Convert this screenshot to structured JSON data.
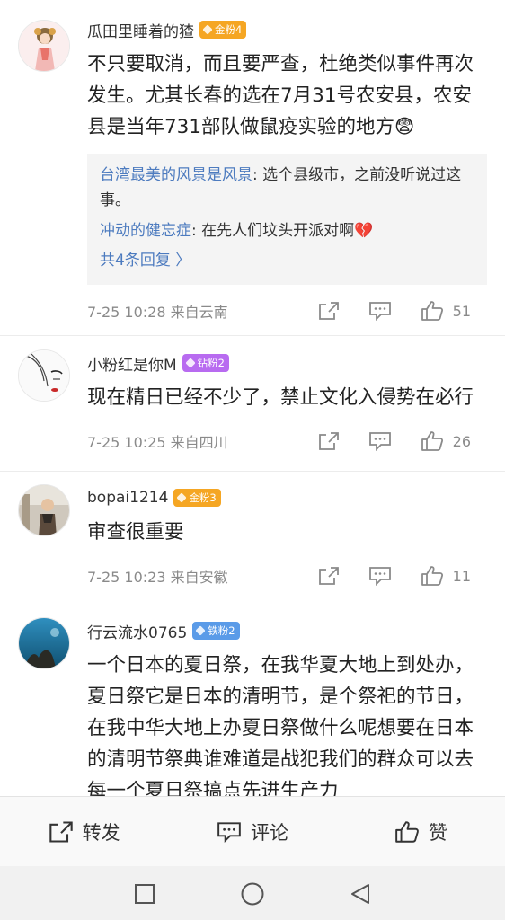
{
  "comments": [
    {
      "username": "瓜田里睡着的猹",
      "badge": "金粉4",
      "badge_color": "#f5a623",
      "text": "不只要取消，而且要严查，杜绝类似事件再次发生。尤其长春的选在7月31号农安县，农安县是当年731部队做鼠疫实验的地方😨",
      "replies": [
        {
          "name": "台湾最美的风景是风景",
          "text": ": 选个县级市，之前没听说过这事。"
        },
        {
          "name": "冲动的健忘症",
          "text": ": 在先人们坟头开派对啊💔"
        }
      ],
      "more_replies": "共4条回复 〉",
      "meta": "7-25 10:28  来自云南",
      "likes": "51"
    },
    {
      "username": "小粉红是你M",
      "badge": "钻粉2",
      "badge_color": "#b86bf0",
      "text": "现在精日已经不少了，禁止文化入侵势在必行",
      "meta": "7-25 10:25  来自四川",
      "likes": "26"
    },
    {
      "username": "bopai1214",
      "badge": "金粉3",
      "badge_color": "#f5a623",
      "text": "审查很重要",
      "meta": "7-25 10:23  来自安徽",
      "likes": "11"
    },
    {
      "username": "行云流水0765",
      "badge": "铁粉2",
      "badge_color": "#5a9be8",
      "text": "一个日本的夏日祭，在我华夏大地上到处办，夏日祭它是日本的清明节，是个祭祀的节日，在我中华大地上办夏日祭做什么呢想要在日本的清明节祭典谁难道是战犯我们的群众可以去每一个夏日祭搞点先进生产力"
    }
  ],
  "bottom_bar": {
    "repost": "转发",
    "comment": "评论",
    "like": "赞"
  },
  "nav_icons": [
    "recent-apps-square",
    "home-circle",
    "back-triangle"
  ],
  "accent_color": "#4d7bbf"
}
